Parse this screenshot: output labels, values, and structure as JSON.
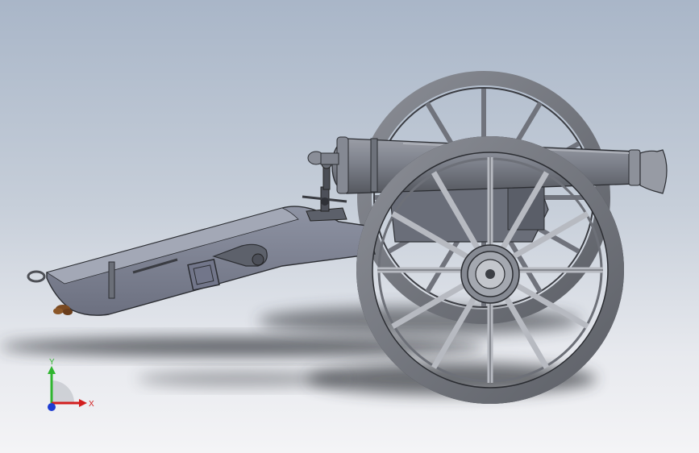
{
  "view": {
    "background_top": "#a9b6c8",
    "background_bottom": "#f4f4f6",
    "model_color": "#7b7f8a",
    "shadow_color": "#3a3d42"
  },
  "triad": {
    "x_label": "X",
    "y_label": "Y",
    "x_color": "#d21e1e",
    "y_color": "#2fb52f",
    "z_color": "#1e3cd2"
  },
  "model": {
    "parts": [
      "trail",
      "barrel",
      "near-wheel",
      "far-wheel",
      "elevating-screw",
      "sight"
    ]
  }
}
